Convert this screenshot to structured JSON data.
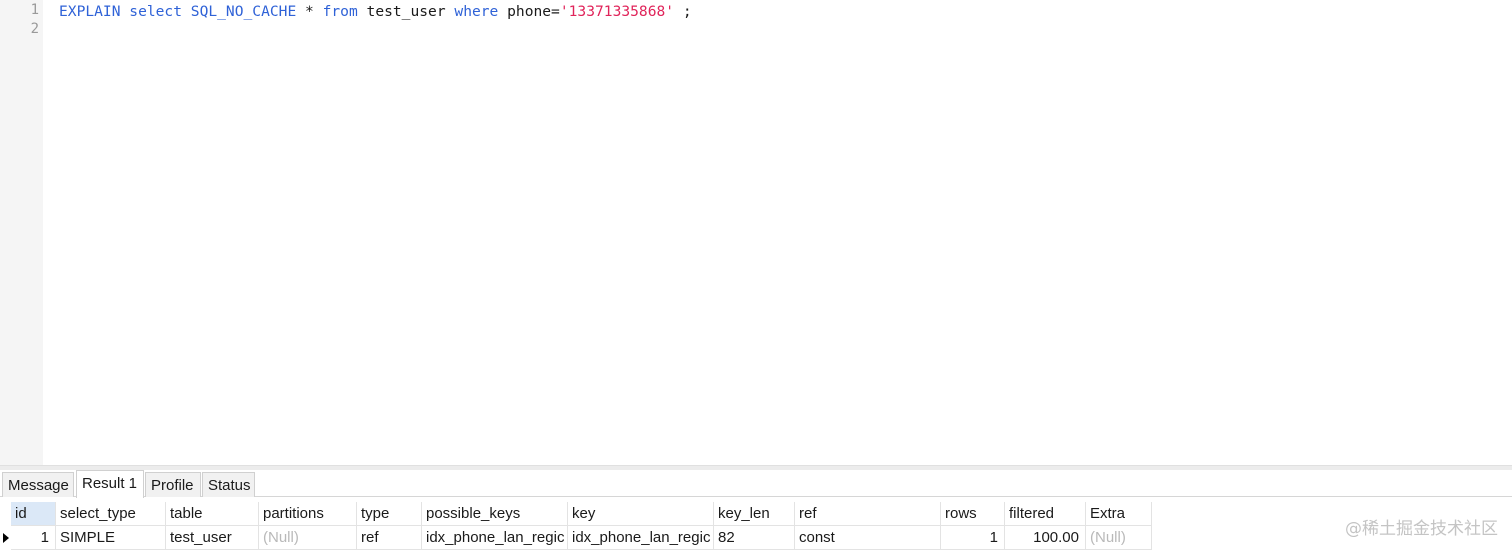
{
  "editor": {
    "line_numbers": [
      "1",
      "2"
    ],
    "line1": {
      "kw1": "EXPLAIN select SQL_NO_CACHE",
      "t1": " * ",
      "kw2": "from",
      "t2": " test_user ",
      "kw3": "where",
      "t3": " phone=",
      "str": "'13371335868'",
      "t4": " ;"
    }
  },
  "tabs": [
    {
      "label": "Message",
      "active": false
    },
    {
      "label": "Result 1",
      "active": true
    },
    {
      "label": "Profile",
      "active": false
    },
    {
      "label": "Status",
      "active": false
    }
  ],
  "result": {
    "columns": [
      "id",
      "select_type",
      "table",
      "partitions",
      "type",
      "possible_keys",
      "key",
      "key_len",
      "ref",
      "rows",
      "filtered",
      "Extra"
    ],
    "row": [
      "1",
      "SIMPLE",
      "test_user",
      "(Null)",
      "ref",
      "idx_phone_lan_regic",
      "idx_phone_lan_regic",
      "82",
      "const",
      "1",
      "100.00",
      "(Null)"
    ]
  },
  "watermark": "@稀土掘金技术社区",
  "icons": {
    "row_indicator": "row-pointer-icon"
  }
}
